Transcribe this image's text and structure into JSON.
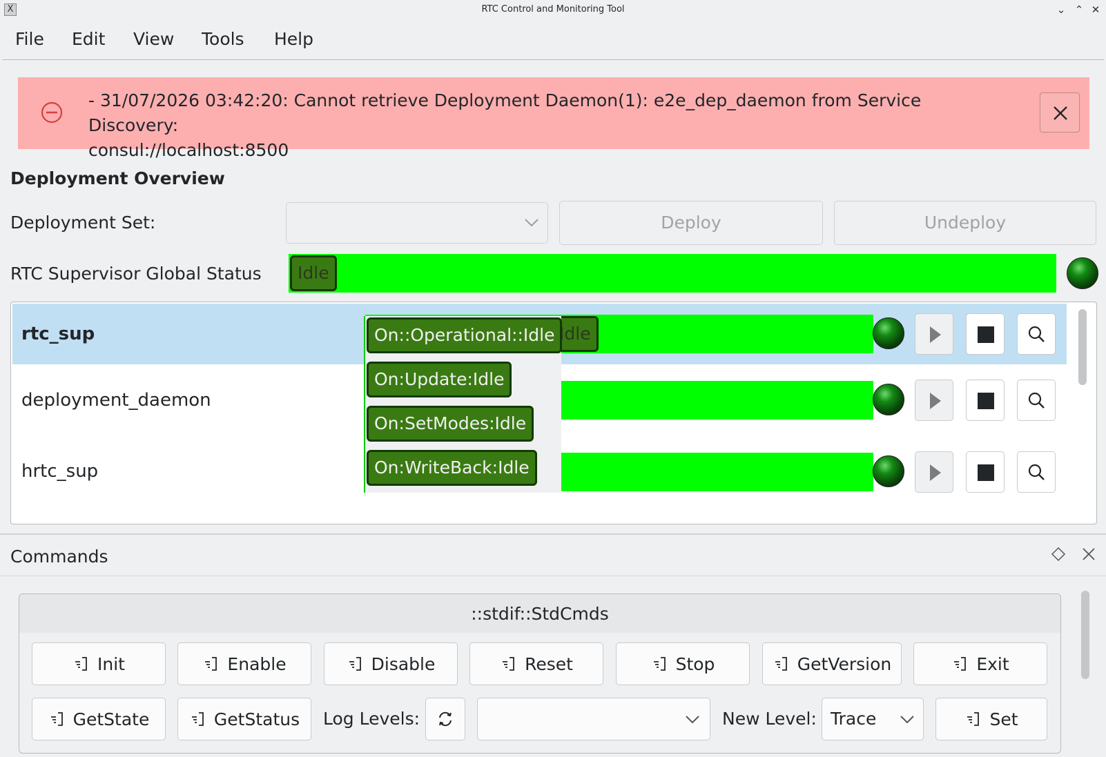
{
  "window": {
    "title": "RTC Control and Monitoring Tool"
  },
  "menu": {
    "items": [
      "File",
      "Edit",
      "View",
      "Tools",
      "Help"
    ]
  },
  "error_banner": {
    "message_line1": "- 31/07/2026 03:42:20: Cannot retrieve Deployment Daemon(1): e2e_dep_daemon from Service Discovery:",
    "message_line2": "consul://localhost:8500"
  },
  "deployment": {
    "heading": "Deployment Overview",
    "set_label": "Deployment Set:",
    "set_value": "",
    "deploy_label": "Deploy",
    "undeploy_label": "Undeploy",
    "global_status_label": "RTC Supervisor Global Status",
    "global_status_value": "Idle"
  },
  "components": [
    {
      "name": "rtc_sup",
      "status": "Idle",
      "selected": true
    },
    {
      "name": "deployment_daemon",
      "status": "",
      "selected": false
    },
    {
      "name": "hrtc_sup",
      "status": "",
      "selected": false
    }
  ],
  "state_popup": {
    "items": [
      "On::Operational::Idle",
      "On:Update:Idle",
      "On:SetModes:Idle",
      "On:WriteBack:Idle"
    ]
  },
  "commands": {
    "dock_title": "Commands",
    "group_title": "::stdif::StdCmds",
    "row1": [
      "Init",
      "Enable",
      "Disable",
      "Reset",
      "Stop",
      "GetVersion",
      "Exit"
    ],
    "row2": [
      "GetState",
      "GetStatus"
    ],
    "log_levels_label": "Log Levels:",
    "log_levels_value": "",
    "new_level_label": "New Level:",
    "new_level_value": "Trace",
    "set_label": "Set"
  },
  "colors": {
    "status_green": "#00ff00",
    "badge_green": "#3a7a12",
    "error_bg": "#fdafaf",
    "selection": "#c0dff3"
  }
}
